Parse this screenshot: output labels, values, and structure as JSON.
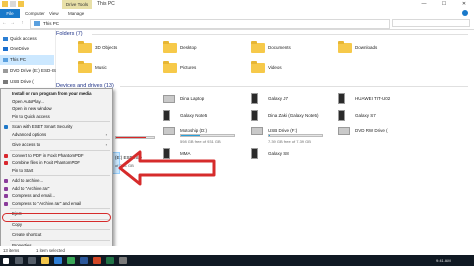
{
  "titlebar": {
    "context_tab": "Drive Tools",
    "title": "This PC",
    "minimize": "—",
    "maximize": "☐",
    "close": "✕"
  },
  "ribbon": {
    "tabs": [
      "File",
      "Computer",
      "View",
      "Manage"
    ]
  },
  "address": {
    "path": "This PC",
    "back": "←",
    "forward": "→",
    "up": "↑"
  },
  "nav_pane": {
    "items": [
      {
        "label": "Quick access",
        "icon": "star-icon"
      },
      {
        "label": "OneDrive",
        "icon": "cloud-icon"
      },
      {
        "label": "This PC",
        "icon": "computer-icon"
      },
      {
        "label": "DVD Drive (E:) ESD-IS",
        "icon": "dvd-icon"
      },
      {
        "label": "USB Drive (",
        "icon": "usb-icon"
      }
    ]
  },
  "groups": {
    "folders": "Folders (7)",
    "devices": "Devices and drives (13)"
  },
  "folders": [
    {
      "name": "3D Objects"
    },
    {
      "name": "Desktop"
    },
    {
      "name": "Documents"
    },
    {
      "name": "Downloads"
    },
    {
      "name": "Music"
    },
    {
      "name": "Pictures"
    },
    {
      "name": "Videos"
    }
  ],
  "devices_row1": [
    {
      "name": "Dina Laptop"
    },
    {
      "name": "Galaxy J7"
    },
    {
      "name": "HUAWEI TIT-U02"
    }
  ],
  "devices_row2": [
    {
      "name": "Galaxy Note5"
    },
    {
      "name": "Dina Zaki (Galaxy Note5)"
    },
    {
      "name": "Galaxy S7"
    }
  ],
  "devices_row3": [
    {
      "name": "Motoship (D:)",
      "free": "598 GB free of 931 GB",
      "fill": 0.36
    },
    {
      "name": "USB Drive (F:)",
      "free": "7.39 GB free of 7.39 GB",
      "fill": 0.02
    },
    {
      "name": "DVD RW Drive (",
      "free": "",
      "fill": 0
    }
  ],
  "devices_row4": [
    {
      "name": "MMA"
    },
    {
      "name": "Galaxy S8"
    }
  ],
  "left_drive_bar_fill": 0.8,
  "selected_drive": {
    "line1": "(E:) ESD-ISO",
    "line2": "of 3.11 GB"
  },
  "context_menu": {
    "items": [
      {
        "label": "Install or run program from your media",
        "bold": true
      },
      {
        "label": "Open AutoPlay..."
      },
      {
        "label": "Open in new window"
      },
      {
        "label": "Pin to Quick access"
      },
      {
        "sep": true
      },
      {
        "label": "Scan with ESET Smart Security",
        "icon": "#1e78c8"
      },
      {
        "label": "Advanced options",
        "sub": "›"
      },
      {
        "sep": true
      },
      {
        "label": "Give access to",
        "sub": "›"
      },
      {
        "sep": true
      },
      {
        "label": "Convert to PDF in Foxit PhantomPDF",
        "icon": "#d9282f"
      },
      {
        "label": "Combine files in Foxit PhantomPDF",
        "icon": "#d9282f"
      },
      {
        "label": "Pin to Start"
      },
      {
        "sep": true
      },
      {
        "label": "Add to archive...",
        "icon": "#8a3b9a"
      },
      {
        "label": "Add to \"Archive.rar\"",
        "icon": "#8a3b9a"
      },
      {
        "label": "Compress and email...",
        "icon": "#8a3b9a"
      },
      {
        "label": "Compress to \"Archive.rar\" and email",
        "icon": "#8a3b9a"
      },
      {
        "sep": true
      },
      {
        "label": "Eject"
      },
      {
        "sep": true
      },
      {
        "label": "Copy"
      },
      {
        "sep": true
      },
      {
        "label": "Create shortcut"
      },
      {
        "sep": true
      },
      {
        "label": "Properties"
      }
    ]
  },
  "statusbar": {
    "items": "13 items",
    "selected": "1 item selected"
  },
  "taskbar": {
    "clock": "9:41 AM",
    "date": "3/7/2019"
  },
  "colors": {
    "accent": "#1979ca",
    "highlight": "#cce8ff",
    "arrow": "#d62b2b"
  }
}
